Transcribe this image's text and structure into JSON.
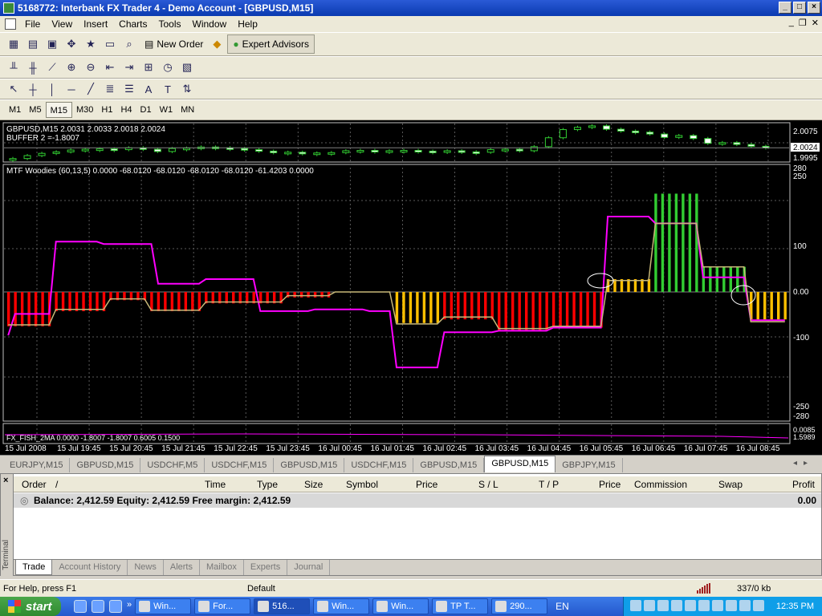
{
  "window": {
    "title": "5168772: Interbank FX Trader 4 - Demo Account - [GBPUSD,M15]"
  },
  "menu": [
    "File",
    "View",
    "Insert",
    "Charts",
    "Tools",
    "Window",
    "Help"
  ],
  "toolbar": {
    "new_order": "New Order",
    "expert_advisors": "Expert Advisors"
  },
  "timeframes": {
    "items": [
      "M1",
      "M5",
      "M15",
      "M30",
      "H1",
      "H4",
      "D1",
      "W1",
      "MN"
    ],
    "active": "M15"
  },
  "price_chart": {
    "header": "GBPUSD,M15  2.0031 2.0033 2.0018 2.0024",
    "buffer": "BUFFER 2 =-1.8007",
    "scale": [
      "2.0075",
      "2.0024",
      "1.9995"
    ],
    "prices": [
      1.9995,
      2.0003,
      2.0009,
      2.0013,
      2.0018,
      2.002,
      2.0021,
      2.0019,
      2.0024,
      2.002,
      2.0014,
      2.0022,
      2.0023,
      2.0026,
      2.0024,
      2.0022,
      2.0019,
      2.0015,
      2.0011,
      2.0012,
      2.0009,
      2.001,
      2.0011,
      2.0016,
      2.0017,
      2.0015,
      2.0016,
      2.0017,
      2.0015,
      2.0014,
      2.0016,
      2.0013,
      2.0012,
      2.0019,
      2.002,
      2.0016,
      2.0027,
      2.0051,
      2.0073,
      2.0079,
      2.0083,
      2.0074,
      2.0069,
      2.0066,
      2.0061,
      2.0052,
      2.0057,
      2.0049,
      2.0036,
      2.0038,
      2.0033,
      2.0028,
      2.0024
    ]
  },
  "indicator": {
    "header": "MTF Woodies (60,13,5) 0.0000 -68.0120 -68.0120 -68.0120 -68.0120 -61.4203 0.0000",
    "scale": [
      "280",
      "250",
      "100",
      "0.00",
      "-100",
      "-250",
      "-280"
    ],
    "ylim": [
      -300,
      300
    ]
  },
  "fisher": {
    "header": "FX_FISH_2MA 0.0000 -1.8007 -1.8007 0.6005 0.1500",
    "scale": [
      "0.0085",
      "1.5989"
    ]
  },
  "time_labels": [
    "15 Jul 2008",
    "15 Jul 19:45",
    "15 Jul 20:45",
    "15 Jul 21:45",
    "15 Jul 22:45",
    "15 Jul 23:45",
    "16 Jul 00:45",
    "16 Jul 01:45",
    "16 Jul 02:45",
    "16 Jul 03:45",
    "16 Jul 04:45",
    "16 Jul 05:45",
    "16 Jul 06:45",
    "16 Jul 07:45",
    "16 Jul 08:45"
  ],
  "chart_data": {
    "type": "bar",
    "title": "MTF Woodies (60,13,5)",
    "ylim": [
      -300,
      300
    ],
    "categories": [
      "15 Jul 2008",
      "15 Jul 19:45",
      "15 Jul 20:45",
      "15 Jul 21:45",
      "15 Jul 22:45",
      "15 Jul 23:45",
      "16 Jul 00:45",
      "16 Jul 01:45",
      "16 Jul 02:45",
      "16 Jul 03:45",
      "16 Jul 04:45",
      "16 Jul 05:45",
      "16 Jul 06:45",
      "16 Jul 07:45",
      "16 Jul 08:45"
    ],
    "histogram": [
      -75,
      -75,
      -75,
      -75,
      -75,
      -75,
      -75,
      -42,
      -42,
      -42,
      -42,
      -42,
      -42,
      -42,
      -42,
      -18,
      -18,
      -18,
      -18,
      -18,
      -18,
      -42,
      -42,
      -42,
      -42,
      -42,
      -42,
      -42,
      -42,
      -25,
      -25,
      -25,
      -25,
      -25,
      -25,
      -25,
      -25,
      -25,
      -25,
      -25,
      -25,
      -12,
      -12,
      -12,
      -12,
      -12,
      -12,
      -12,
      0,
      0,
      0,
      0,
      0,
      0,
      0,
      0,
      0,
      -68,
      -68,
      -68,
      -68,
      -68,
      -68,
      -68,
      -60,
      -60,
      -60,
      -60,
      -60,
      -60,
      -60,
      -60,
      -85,
      -85,
      -85,
      -85,
      -85,
      -85,
      -85,
      -85,
      -78,
      -78,
      -78,
      -78,
      -78,
      -78,
      -78,
      -78,
      28,
      28,
      28,
      28,
      28,
      28,
      28,
      215,
      215,
      215,
      215,
      215,
      215,
      215,
      55,
      55,
      55,
      55,
      55,
      55,
      55,
      -60,
      -60,
      -60,
      -60,
      -60,
      -60
    ],
    "bar_colors": [
      "r",
      "r",
      "r",
      "r",
      "r",
      "r",
      "r",
      "r",
      "r",
      "r",
      "r",
      "r",
      "r",
      "r",
      "r",
      "r",
      "r",
      "r",
      "r",
      "r",
      "r",
      "r",
      "r",
      "r",
      "r",
      "r",
      "r",
      "r",
      "r",
      "r",
      "r",
      "r",
      "r",
      "r",
      "r",
      "r",
      "r",
      "r",
      "r",
      "r",
      "r",
      "r",
      "r",
      "r",
      "r",
      "r",
      "r",
      "r",
      "n",
      "n",
      "n",
      "n",
      "n",
      "n",
      "n",
      "n",
      "n",
      "y",
      "y",
      "y",
      "y",
      "y",
      "y",
      "y",
      "r",
      "r",
      "r",
      "r",
      "r",
      "r",
      "r",
      "r",
      "r",
      "r",
      "r",
      "r",
      "r",
      "r",
      "r",
      "r",
      "r",
      "r",
      "r",
      "r",
      "r",
      "r",
      "r",
      "r",
      "y",
      "y",
      "y",
      "y",
      "y",
      "y",
      "y",
      "g",
      "g",
      "g",
      "g",
      "g",
      "g",
      "g",
      "g",
      "g",
      "g",
      "g",
      "g",
      "g",
      "g",
      "y",
      "y",
      "y",
      "y",
      "y",
      "y"
    ],
    "series": [
      {
        "values": [
          -95,
          -48,
          -48,
          -48,
          -48,
          -48,
          -48,
          110,
          110,
          110,
          110,
          110,
          110,
          110,
          105,
          105,
          105,
          105,
          105,
          105,
          105,
          105,
          18,
          18,
          18,
          18,
          18,
          18,
          18,
          28,
          28,
          28,
          28,
          28,
          28,
          28,
          28,
          -42,
          -42,
          -42,
          -42,
          -42,
          -42,
          -42,
          -42,
          -38,
          -38,
          -38,
          -38,
          -38,
          -38,
          -38,
          -38,
          -42,
          -42,
          -42,
          -42,
          -165,
          -165,
          -165,
          -165,
          -165,
          -165,
          -165,
          -88,
          -88,
          -88,
          -88,
          -88,
          -88,
          -88,
          -88,
          -85,
          -85,
          -85,
          -85,
          -85,
          -85,
          -85,
          -85,
          -78,
          -78,
          -78,
          -78,
          -78,
          -78,
          -78,
          -78,
          165,
          165,
          165,
          165,
          165,
          165,
          165,
          150,
          150,
          150,
          150,
          150,
          150,
          150,
          32,
          32,
          32,
          32,
          32,
          32,
          32,
          -62,
          -62,
          -62,
          -62,
          -62,
          -62
        ]
      },
      {
        "values": [
          -72,
          -72,
          -72,
          -72,
          -72,
          -72,
          -72,
          -38,
          -38,
          -38,
          -38,
          -38,
          -38,
          -38,
          -38,
          -15,
          -15,
          -15,
          -15,
          -15,
          -15,
          -40,
          -40,
          -40,
          -40,
          -40,
          -40,
          -40,
          -40,
          -22,
          -22,
          -22,
          -22,
          -22,
          -22,
          -22,
          -22,
          -22,
          -22,
          -22,
          -22,
          -8,
          -8,
          -8,
          -8,
          -8,
          -8,
          -8,
          0,
          0,
          0,
          0,
          0,
          0,
          0,
          0,
          0,
          -70,
          -70,
          -70,
          -70,
          -70,
          -70,
          -70,
          -55,
          -55,
          -55,
          -55,
          -55,
          -55,
          -55,
          -55,
          -80,
          -80,
          -80,
          -80,
          -80,
          -80,
          -80,
          -80,
          -75,
          -75,
          -75,
          -75,
          -75,
          -75,
          -75,
          -75,
          25,
          25,
          25,
          25,
          25,
          25,
          25,
          150,
          150,
          150,
          150,
          150,
          150,
          150,
          55,
          55,
          55,
          55,
          55,
          55,
          55,
          -65,
          -65,
          -65,
          -65,
          -65,
          -65
        ]
      }
    ]
  },
  "colors": {
    "red": "#ff0000",
    "yellow": "#ffc000",
    "green": "#32cd32",
    "magenta": "#ff00ff",
    "signal": "#c8b878",
    "grid": "#5a5a5a"
  },
  "chart_tabs": {
    "items": [
      "EURJPY,M15",
      "GBPUSD,M15",
      "USDCHF,M5",
      "USDCHF,M15",
      "GBPUSD,M15",
      "USDCHF,M15",
      "GBPUSD,M15",
      "GBPUSD,M15",
      "GBPJPY,M15"
    ],
    "active_index": 7
  },
  "terminal": {
    "side_label": "Terminal",
    "columns": [
      "Order",
      "/",
      "Time",
      "Type",
      "Size",
      "Symbol",
      "Price",
      "S / L",
      "T / P",
      "Price",
      "Commission",
      "Swap",
      "Profit"
    ],
    "balance_text": "Balance: 2,412.59  Equity: 2,412.59  Free margin: 2,412.59",
    "profit": "0.00",
    "tabs": [
      "Trade",
      "Account History",
      "News",
      "Alerts",
      "Mailbox",
      "Experts",
      "Journal"
    ],
    "active_tab": "Trade"
  },
  "status": {
    "help": "For Help, press F1",
    "profile": "Default",
    "traffic": "337/0 kb"
  },
  "taskbar": {
    "start": "start",
    "tasks": [
      "Win...",
      "For...",
      "516...",
      "Win...",
      "Win...",
      "TP T...",
      "290..."
    ],
    "active_task": 2,
    "lang": "EN",
    "clock": "12:35 PM"
  }
}
